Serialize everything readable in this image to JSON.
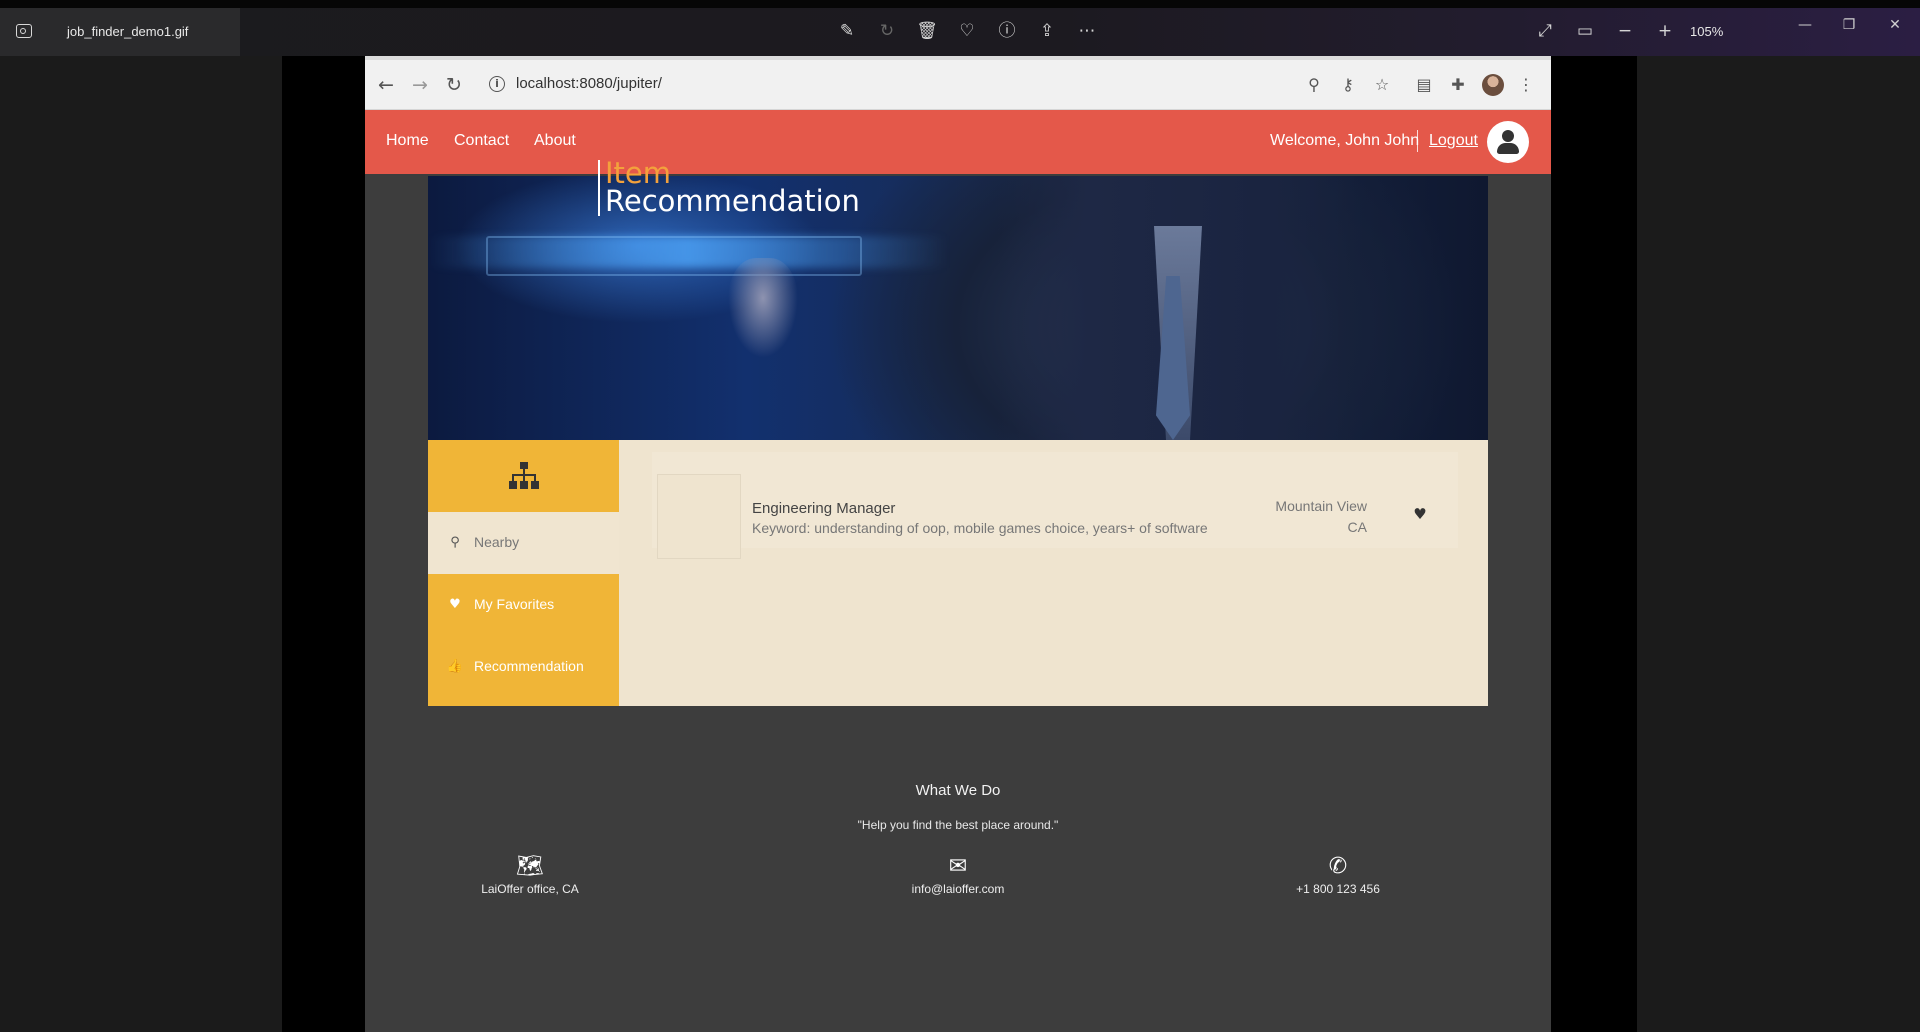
{
  "viewer": {
    "filename": "job_finder_demo1.gif",
    "zoom": "105%"
  },
  "browser": {
    "url": "localhost:8080/jupiter/"
  },
  "header": {
    "nav": [
      "Home",
      "Contact",
      "About"
    ],
    "welcome": "Welcome, John John",
    "logout": "Logout"
  },
  "hero": {
    "title_line1": "Item",
    "title_line2": "Recommendation"
  },
  "sidebar": {
    "items": [
      {
        "label": "Nearby",
        "icon": "map-marker-icon"
      },
      {
        "label": "My Favorites",
        "icon": "heart-icon"
      },
      {
        "label": "Recommendation",
        "icon": "thumbs-up-icon"
      }
    ]
  },
  "items": [
    {
      "title": "Engineering Manager",
      "keyword": "Keyword: understanding of oop, mobile games choice, years+ of software",
      "city": "Mountain View",
      "state": "CA"
    }
  ],
  "footer": {
    "title": "What We Do",
    "quote": "\"Help you find the best place around.\"",
    "contacts": [
      {
        "icon": "map-icon",
        "text": "LaiOffer office, CA"
      },
      {
        "icon": "envelope-icon",
        "text": "info@laioffer.com"
      },
      {
        "icon": "phone-icon",
        "text": "+1 800 123 456"
      }
    ]
  },
  "colors": {
    "header": "#e4584a",
    "accent": "#f0b537",
    "content_bg": "#efe4cf",
    "hero_title_accent": "#f3a13c"
  }
}
